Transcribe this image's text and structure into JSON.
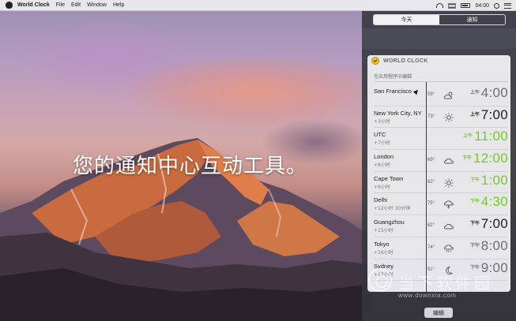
{
  "menubar": {
    "app_name": "World Clock",
    "menus": [
      "File",
      "Edit",
      "Window",
      "Help"
    ],
    "clock": "04:00"
  },
  "caption": "您的通知中心互动工具。",
  "notification_center": {
    "tabs": [
      {
        "label": "今天",
        "active": true
      },
      {
        "label": "通知",
        "active": false
      }
    ],
    "widget": {
      "title": "WORLD CLOCK",
      "edit_in_app": "在应用程序中编辑",
      "rows": [
        {
          "city": "San Francisco",
          "offset": "",
          "temp": "59°",
          "weather": "partly-cloudy-icon",
          "ampm": "上午",
          "time": "4:00",
          "color": "grey",
          "current": true
        },
        {
          "city": "New York City, NY",
          "offset": "+3小时",
          "temp": "73°",
          "weather": "sun-icon",
          "ampm": "上午",
          "time": "7:00",
          "color": "dark"
        },
        {
          "city": "UTC",
          "offset": "+7小时",
          "temp": "",
          "weather": "",
          "ampm": "上午",
          "time": "11:00",
          "color": "green"
        },
        {
          "city": "London",
          "offset": "+8小时",
          "temp": "69°",
          "weather": "cloud-icon",
          "ampm": "下午",
          "time": "12:00",
          "color": "green"
        },
        {
          "city": "Cape Town",
          "offset": "+9小时",
          "temp": "62°",
          "weather": "sun-icon",
          "ampm": "下午",
          "time": "1:00",
          "color": "green"
        },
        {
          "city": "Delhi",
          "offset": "+12小时 30分钟",
          "temp": "75°",
          "weather": "thunderstorm-icon",
          "ampm": "下午",
          "time": "4:30",
          "color": "green"
        },
        {
          "city": "Guangzhou",
          "offset": "+15小时",
          "temp": "82°",
          "weather": "cloud-icon",
          "ampm": "下午",
          "time": "7:00",
          "color": "dark"
        },
        {
          "city": "Tokyo",
          "offset": "+16小时",
          "temp": "74°",
          "weather": "rain-icon",
          "ampm": "下午",
          "time": "8:00",
          "color": "grey"
        },
        {
          "city": "Sydney",
          "offset": "+17小时",
          "temp": "51°",
          "weather": "moon-icon",
          "ampm": "下午",
          "time": "9:00",
          "color": "grey"
        }
      ]
    },
    "edit_button": "编辑"
  },
  "watermark": {
    "name": "当下软件园",
    "url": "www.downxia.com"
  }
}
